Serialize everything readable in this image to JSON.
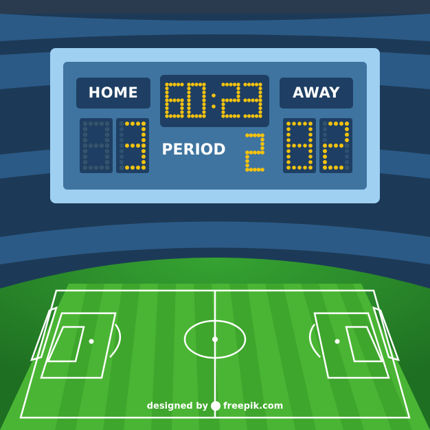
{
  "scoreboard": {
    "home_label": "HOME",
    "away_label": "AWAY",
    "clock_minutes": "60",
    "clock_seconds": "23",
    "clock_separator": ":",
    "period_label": "PERIOD",
    "period_value": "2",
    "home_score": "3",
    "away_score": "2"
  },
  "colors": {
    "digit_lit": "#f5c20f",
    "digit_unlit": "#2f5272",
    "board_frame": "#9fd0f2",
    "board_face": "#3f74a0",
    "panel": "#1e3f63",
    "pitch_light": "#4ab534",
    "pitch_dark": "#3aa02a"
  },
  "credit": {
    "prefix": "designed by",
    "brand": "freepik.com"
  }
}
